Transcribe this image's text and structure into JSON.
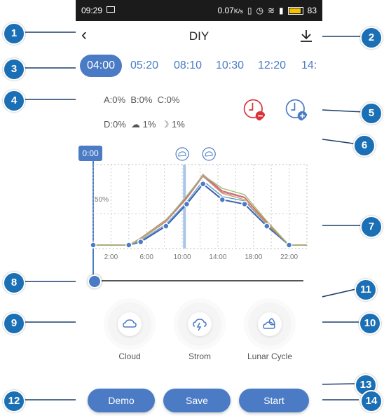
{
  "status_bar": {
    "time": "09:29",
    "network_speed": "0.07",
    "speed_unit": "K/s",
    "battery": "83"
  },
  "header": {
    "title": "DIY",
    "back_icon": "chevron-left-icon",
    "download_icon": "download-icon"
  },
  "tabs": [
    {
      "label": "04:00",
      "active": true
    },
    {
      "label": "05:20",
      "active": false
    },
    {
      "label": "08:10",
      "active": false
    },
    {
      "label": "10:30",
      "active": false
    },
    {
      "label": "12:20",
      "active": false
    },
    {
      "label": "14:",
      "active": false
    }
  ],
  "levels": {
    "a": "A:0%",
    "b": "B:0%",
    "c": "C:0%",
    "d": "D:0%",
    "cloud": "1%",
    "moon": "1%"
  },
  "time_marker": "0:00",
  "chart_data": {
    "type": "line",
    "x_ticks": [
      "2:00",
      "6:00",
      "10:00",
      "14:00",
      "18:00",
      "22:00"
    ],
    "y_label": "50%",
    "xlim": [
      0,
      24
    ],
    "ylim": [
      0,
      100
    ],
    "x": [
      0,
      4,
      5.33,
      8.17,
      10.5,
      12.33,
      14.5,
      17,
      19.5,
      22,
      24
    ],
    "series": [
      {
        "color": "#3f5fa8",
        "values": [
          0,
          0,
          5,
          30,
          65,
          97,
          72,
          65,
          30,
          0,
          0
        ]
      },
      {
        "color": "#5aa0d8",
        "values": [
          0,
          0,
          7,
          33,
          68,
          102,
          77,
          70,
          33,
          0,
          0
        ]
      },
      {
        "color": "#d9a04a",
        "values": [
          0,
          0,
          9,
          37,
          74,
          109,
          82,
          72,
          34,
          0,
          0
        ]
      },
      {
        "color": "#b86fc0",
        "values": [
          0,
          0,
          10,
          38,
          75,
          110,
          84,
          75,
          36,
          0,
          0
        ]
      },
      {
        "color": "#d96a5a",
        "values": [
          0,
          0,
          11,
          40,
          76,
          112,
          86,
          76,
          36,
          0,
          0
        ]
      },
      {
        "color": "#9ec07a",
        "values": [
          0,
          0,
          10,
          39,
          78,
          111,
          90,
          80,
          38,
          0,
          0
        ]
      }
    ],
    "marked_points": [
      0,
      4,
      5.33,
      8.17,
      10.5,
      12.33,
      14.5,
      17,
      19.5,
      22
    ],
    "cursor_x": 10.25,
    "weather_markers": [
      {
        "icon": "cloud-icon",
        "x": 10.0
      },
      {
        "icon": "storm-icon",
        "x": 13.0
      }
    ]
  },
  "effects": [
    {
      "label": "Cloud",
      "icon": "cloud-icon"
    },
    {
      "label": "Strom",
      "icon": "storm-icon"
    },
    {
      "label": "Lunar Cycle",
      "icon": "moon-cloud-icon"
    }
  ],
  "buttons": {
    "demo": "Demo",
    "save": "Save",
    "start": "Start"
  },
  "callouts": [
    "1",
    "2",
    "3",
    "4",
    "5",
    "6",
    "7",
    "8",
    "9",
    "10",
    "11",
    "12",
    "13",
    "14"
  ],
  "colors": {
    "accent": "#4a7bc4",
    "callout": "#1a6fb5",
    "delete": "#d9333a"
  }
}
